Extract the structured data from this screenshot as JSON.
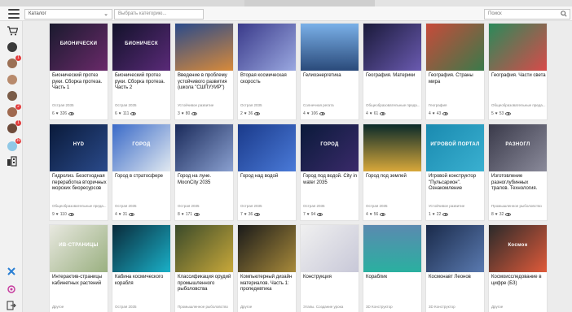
{
  "header": {
    "category_select": "Каталог",
    "category_placeholder": "Выбрать категорию...",
    "search_placeholder": "Поиск"
  },
  "sidebar": {
    "badges": [
      "1",
      "2",
      "1",
      "10"
    ]
  },
  "cards": [
    {
      "title": "Бионический протез руки. Сборка протеза. Часть 1",
      "thumb_text": "БИОНИЧЕСКИ",
      "sub": "Острая 2035",
      "likes": "6",
      "views": "326"
    },
    {
      "title": "Бионический протез руки. Сборка протеза. Часть 2",
      "thumb_text": "БИОНИЧЕСК",
      "sub": "Острая 2035",
      "likes": "6",
      "views": "111"
    },
    {
      "title": "Введение в проблему устойчивого развития (школа \"СШПУУИР\")",
      "thumb_text": "",
      "sub": "Устойчивое развитие",
      "likes": "3",
      "views": "80"
    },
    {
      "title": "Вторая космическая скорость",
      "thumb_text": "",
      "sub": "Острая 2035",
      "likes": "2",
      "views": "36"
    },
    {
      "title": "Гелиоэнергетика",
      "thumb_text": "",
      "sub": "Солнечная регата",
      "likes": "4",
      "views": "106"
    },
    {
      "title": "География. Материки",
      "thumb_text": "",
      "sub": "Общеобразовательные преда...",
      "likes": "4",
      "views": "61"
    },
    {
      "title": "География. Страны мира",
      "thumb_text": "",
      "sub": "География",
      "likes": "4",
      "views": "43"
    },
    {
      "title": "География. Части света",
      "thumb_text": "",
      "sub": "Общеобразовательные преда...",
      "likes": "5",
      "views": "53"
    },
    {
      "title": "Гидролиз. Безотходная переработка вторичных морских биоресурсов",
      "thumb_text": "HYD",
      "sub": "Общеобразовательные преда...",
      "likes": "9",
      "views": "110"
    },
    {
      "title": "Город в стратосфере",
      "thumb_text": "ГОРОД",
      "sub": "Острая 2035",
      "likes": "4",
      "views": "31"
    },
    {
      "title": "Город на луне. MoonCity 2035",
      "thumb_text": "",
      "sub": "Острая 2035",
      "likes": "8",
      "views": "171"
    },
    {
      "title": "Город над водой",
      "thumb_text": "",
      "sub": "Острая 2035",
      "likes": "7",
      "views": "36"
    },
    {
      "title": "Город под водой. City in water 2035",
      "thumb_text": "ГОРОД",
      "sub": "Острая 2035",
      "likes": "7",
      "views": "94"
    },
    {
      "title": "Город под землей",
      "thumb_text": "",
      "sub": "Острая 2035",
      "likes": "4",
      "views": "56"
    },
    {
      "title": "Игровой конструктор \"Пульсарион\". Ознакомление",
      "thumb_text": "ИГРОВОЙ ПОРТАЛ",
      "sub": "Устойчивое развитие",
      "likes": "1",
      "views": "22"
    },
    {
      "title": "Изготовление разноглубинных тралов. Технология.",
      "thumb_text": "РАЗНОГЛ",
      "sub": "Промышленное рыболовство",
      "likes": "8",
      "views": "32"
    },
    {
      "title": "Интерактив-страницы кабинетных растений",
      "thumb_text": "ИВ-СТРАНИЦЫ",
      "sub": "Другое",
      "likes": "",
      "views": ""
    },
    {
      "title": "Кабина космического корабля",
      "thumb_text": "",
      "sub": "Острая 2035",
      "likes": "",
      "views": ""
    },
    {
      "title": "Классификация орудий промышленного рыболовства",
      "thumb_text": "",
      "sub": "Промышленное рыболовство",
      "likes": "",
      "views": ""
    },
    {
      "title": "Компьютерный дизайн материалов. Часть 1: пропедевтика",
      "thumb_text": "",
      "sub": "Другое",
      "likes": "",
      "views": ""
    },
    {
      "title": "Конструкция",
      "thumb_text": "",
      "sub": "Этапы. Создание урока",
      "likes": "",
      "views": ""
    },
    {
      "title": "Кораблик",
      "thumb_text": "",
      "sub": "3D Конструктор",
      "likes": "",
      "views": ""
    },
    {
      "title": "Космонавт Леонов",
      "thumb_text": "",
      "sub": "3D Конструктор",
      "likes": "",
      "views": ""
    },
    {
      "title": "Космоисследование в цифре (БЗ)",
      "thumb_text": "Космон",
      "sub": "Другое",
      "likes": "",
      "views": ""
    }
  ]
}
